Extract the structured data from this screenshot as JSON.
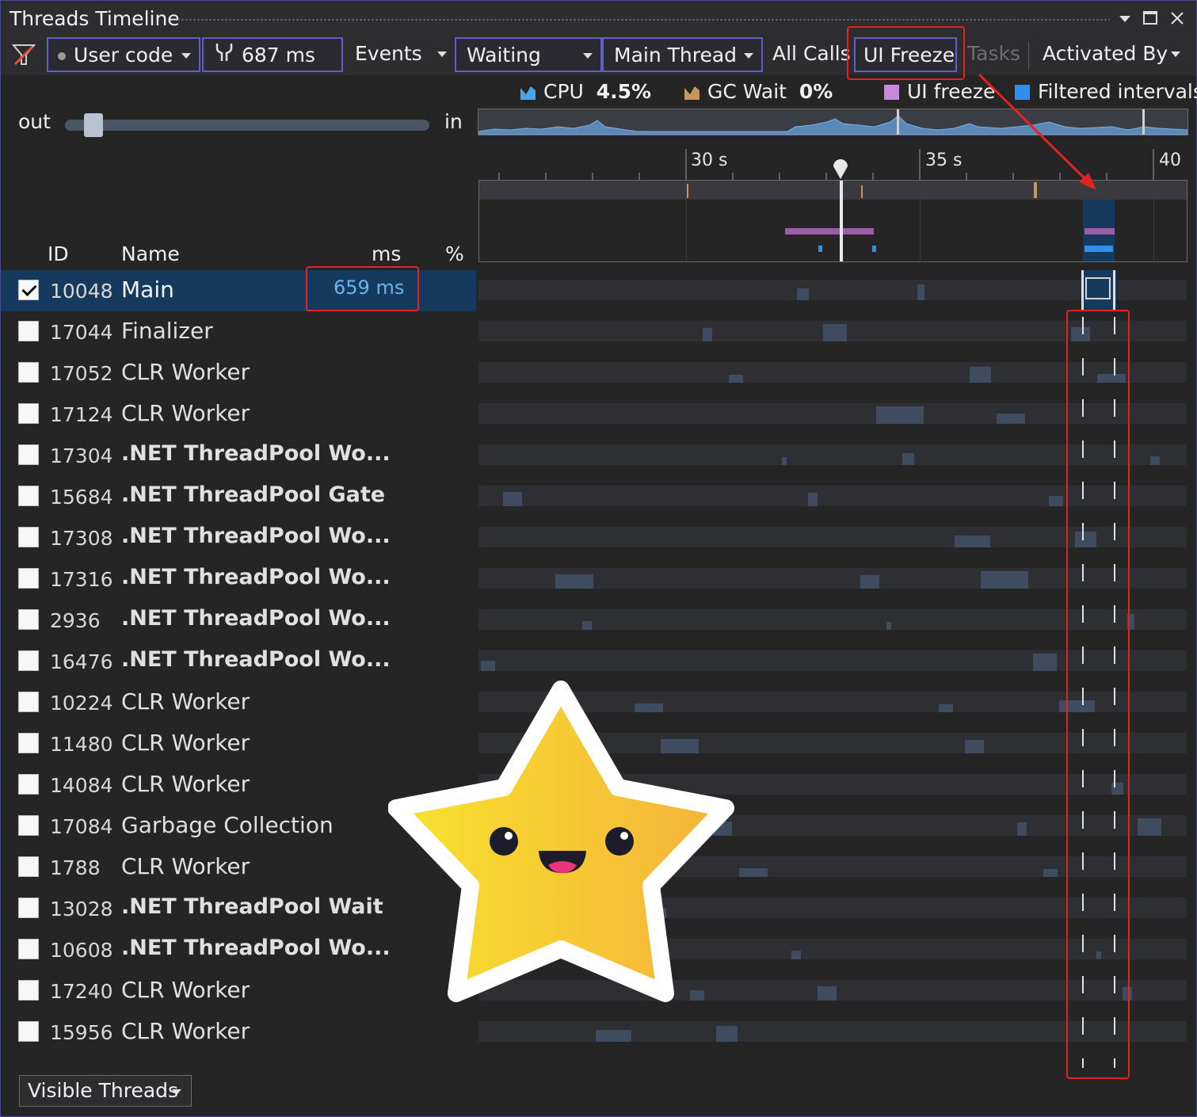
{
  "window": {
    "title": "Threads Timeline",
    "controls": {
      "dropdown": "chevron-down-icon",
      "maximize": "maximize-icon",
      "close": "close-icon"
    }
  },
  "toolbar": {
    "clear_filter_icon": "clear-filter-icon",
    "user_code_label": "User code",
    "duration_label": "687 ms",
    "events_label": "Events",
    "waiting_label": "Waiting",
    "main_thread_label": "Main Thread",
    "all_calls_label": "All Calls",
    "ui_freeze_label": "UI Freeze",
    "tasks_label": "Tasks",
    "activated_by_label": "Activated By"
  },
  "legend": {
    "cpu_label": "CPU",
    "cpu_value": "4.5%",
    "gc_label": "GC Wait",
    "gc_value": "0%",
    "ui_freeze_label": "UI freeze",
    "filtered_label": "Filtered intervals",
    "colors": {
      "cpu": "#4aa3e8",
      "gc": "#c8965a",
      "ui_freeze": "#c88ad6",
      "filtered": "#2f8fef"
    }
  },
  "zoom": {
    "out_label": "out",
    "in_label": "in"
  },
  "ruler": {
    "labels": [
      "30 s",
      "35 s",
      "40 s"
    ]
  },
  "columns": {
    "id": "ID",
    "name": "Name",
    "ms": "ms",
    "percent": "%"
  },
  "threads": [
    {
      "id": "10048",
      "name": "Main",
      "ms": "659 ms",
      "checked": true,
      "selected": true,
      "bold": false
    },
    {
      "id": "17044",
      "name": "Finalizer",
      "checked": false,
      "bold": false
    },
    {
      "id": "17052",
      "name": "CLR Worker",
      "checked": false,
      "bold": false
    },
    {
      "id": "17124",
      "name": "CLR Worker",
      "checked": false,
      "bold": false
    },
    {
      "id": "17304",
      "name": ".NET ThreadPool Wo...",
      "checked": false,
      "bold": true
    },
    {
      "id": "15684",
      "name": ".NET ThreadPool Gate",
      "checked": false,
      "bold": true
    },
    {
      "id": "17308",
      "name": ".NET ThreadPool Wo...",
      "checked": false,
      "bold": true
    },
    {
      "id": "17316",
      "name": ".NET ThreadPool Wo...",
      "checked": false,
      "bold": true
    },
    {
      "id": "2936",
      "name": ".NET ThreadPool Wo...",
      "checked": false,
      "bold": true
    },
    {
      "id": "16476",
      "name": ".NET ThreadPool Wo...",
      "checked": false,
      "bold": true
    },
    {
      "id": "10224",
      "name": "CLR Worker",
      "checked": false,
      "bold": false
    },
    {
      "id": "11480",
      "name": "CLR Worker",
      "checked": false,
      "bold": false
    },
    {
      "id": "14084",
      "name": "CLR Worker",
      "checked": false,
      "bold": false
    },
    {
      "id": "17084",
      "name": "Garbage Collection",
      "checked": false,
      "bold": false
    },
    {
      "id": "1788",
      "name": "CLR Worker",
      "checked": false,
      "bold": false
    },
    {
      "id": "13028",
      "name": ".NET ThreadPool Wait",
      "checked": false,
      "bold": true
    },
    {
      "id": "10608",
      "name": ".NET ThreadPool Wo...",
      "checked": false,
      "bold": true
    },
    {
      "id": "17240",
      "name": "CLR Worker",
      "checked": false,
      "bold": false
    },
    {
      "id": "15956",
      "name": "CLR Worker",
      "checked": false,
      "bold": false
    }
  ],
  "footer": {
    "visible_threads_label": "Visible Threads"
  }
}
